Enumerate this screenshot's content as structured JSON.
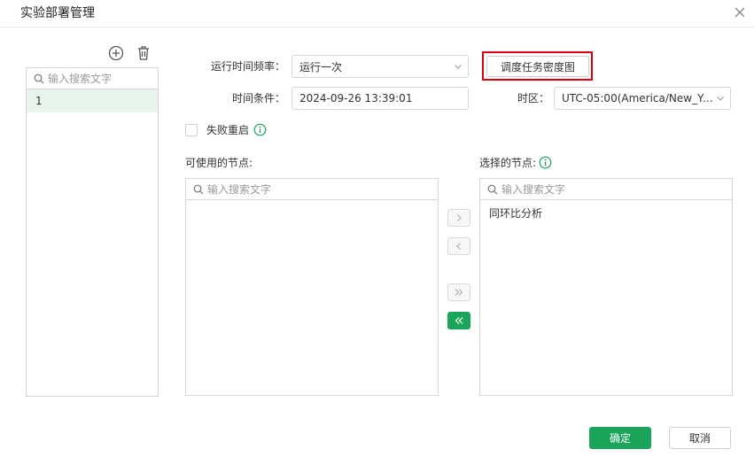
{
  "dialog": {
    "title": "实验部署管理",
    "close_icon": "close-icon"
  },
  "left": {
    "add_icon": "add-circle-icon",
    "delete_icon": "trash-icon",
    "search_placeholder": "输入搜索文字",
    "items": [
      "1"
    ]
  },
  "form": {
    "frequency_label": "运行时间频率：",
    "frequency_value": "运行一次",
    "schedule_density_button": "调度任务密度图",
    "time_condition_label": "时间条件：",
    "time_condition_value": "2024-09-26 13:39:01",
    "timezone_label": "时区：",
    "timezone_value": "UTC-05:00(America/New_York ...",
    "retry_label": "失败重启",
    "retry_checked": false
  },
  "available": {
    "label": "可使用的节点:",
    "search_placeholder": "输入搜索文字",
    "items": []
  },
  "selected": {
    "label": "选择的节点:",
    "search_placeholder": "输入搜索文字",
    "items": [
      "同环比分析"
    ]
  },
  "transfer": {
    "move_right": "chevron-right-icon",
    "move_left": "chevron-left-icon",
    "move_all_right": "double-chevron-right-icon",
    "move_all_left": "double-chevron-left-icon"
  },
  "footer": {
    "confirm_label": "确定",
    "cancel_label": "取消"
  },
  "colors": {
    "primary": "#1aa55a",
    "highlight": "#d9000f",
    "info_icon": "#1aa55a",
    "selected_row": "#e8f5ec"
  }
}
